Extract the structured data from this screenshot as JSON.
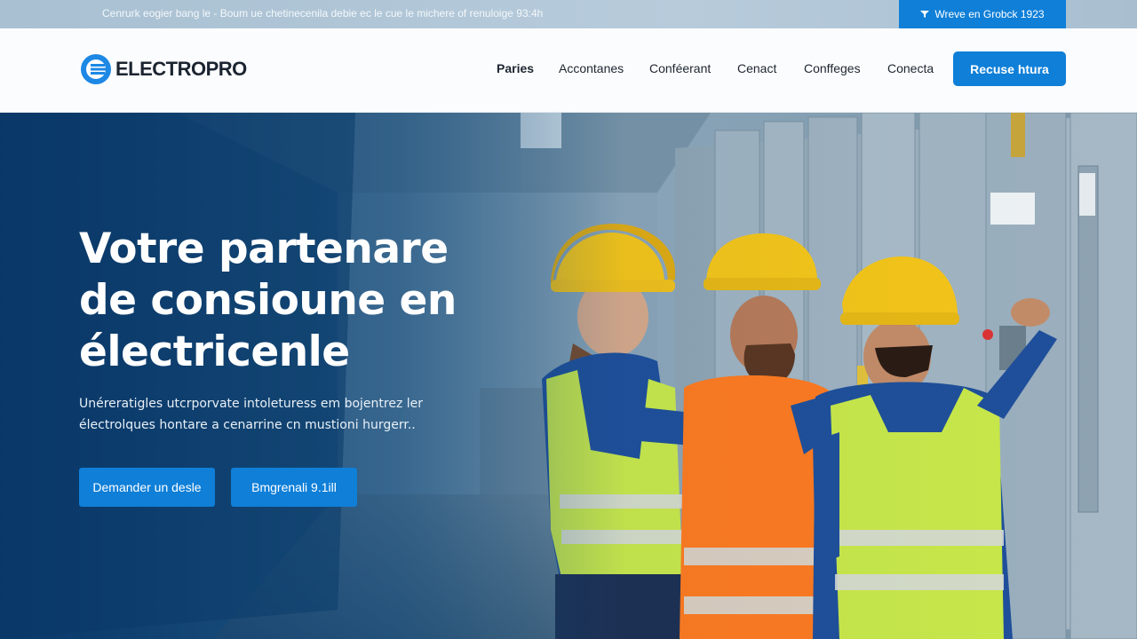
{
  "topbar": {
    "announcement": "Cenrurk eogier bang le - Boum ue chetinecenila debie ec le cue le michere of renuloige 93:4h",
    "cta_label": "Wreve en Grobck 1923",
    "cta_icon": "filter-icon"
  },
  "header": {
    "logo": {
      "text": "ELECTROPRO",
      "icon": "electropro-logo-mark",
      "color": "#1e88e5"
    },
    "nav": [
      {
        "label": "Paries",
        "active": true
      },
      {
        "label": "Accontanes",
        "active": false
      },
      {
        "label": "Conféerant",
        "active": false
      },
      {
        "label": "Cenact",
        "active": false
      },
      {
        "label": "Conffeges",
        "active": false
      },
      {
        "label": "Conecta",
        "active": false
      }
    ],
    "cta_label": "Recuse htura"
  },
  "hero": {
    "title_lines": [
      "Votre partenare",
      "de consioune en",
      "électricenle"
    ],
    "subtitle_lines": [
      "Unéreratigles utcrporvate intoleturess em bojentrez ler",
      "électrolques hontare a cenarrine cn mustioni hurgerr.."
    ],
    "primary_button": "Demander un desle",
    "secondary_button": "Bmgrenali 9.1ill"
  },
  "colors": {
    "accent": "#0f7fd8",
    "topbar_bg": "#b0c6d6",
    "header_bg": "#fbfcfd",
    "hero_overlay": "#0b3a6b",
    "helmet": "#f5c518",
    "vest": "#c9e84a",
    "orange_vest": "#ff7a1f"
  }
}
